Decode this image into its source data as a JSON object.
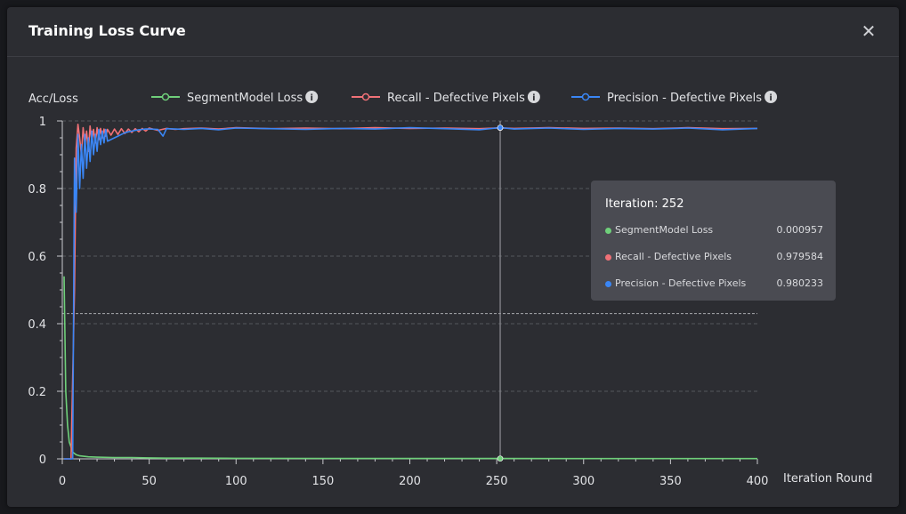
{
  "dialog": {
    "title": "Training Loss Curve",
    "close_icon": "close-icon"
  },
  "chart_data": {
    "type": "line",
    "ylabel": "Acc/Loss",
    "xlabel": "Iteration Round",
    "xlim": [
      0,
      400
    ],
    "ylim": [
      0,
      1
    ],
    "x_ticks": [
      "0",
      "50",
      "100",
      "150",
      "200",
      "250",
      "300",
      "350",
      "400"
    ],
    "y_ticks": [
      "0",
      "0.2",
      "0.4",
      "0.6",
      "0.8",
      "1"
    ],
    "grid": "horizontal-dashed",
    "reference_line_y": 0.43,
    "hover_x": 252,
    "legend_position": "top",
    "info_icon": "info-icon",
    "series": [
      {
        "name": "SegmentModel Loss",
        "color": "#6fcf7a",
        "x": [
          1,
          2,
          3,
          4,
          5,
          6,
          8,
          10,
          15,
          20,
          30,
          40,
          50,
          60,
          80,
          100,
          150,
          200,
          252,
          300,
          350,
          400
        ],
        "values": [
          0.54,
          0.2,
          0.1,
          0.05,
          0.035,
          0.02,
          0.012,
          0.009,
          0.006,
          0.005,
          0.004,
          0.004,
          0.003,
          0.002,
          0.002,
          0.0015,
          0.0012,
          0.001,
          0.000957,
          0.0009,
          0.0009,
          0.0009
        ]
      },
      {
        "name": "Recall - Defective Pixels",
        "color": "#f07177",
        "x": [
          1,
          5,
          7,
          8,
          9,
          10,
          11,
          12,
          13,
          14,
          15,
          16,
          17,
          18,
          19,
          20,
          21,
          22,
          23,
          24,
          25,
          26,
          28,
          30,
          32,
          34,
          36,
          38,
          40,
          42,
          44,
          46,
          48,
          50,
          55,
          60,
          65,
          70,
          80,
          90,
          100,
          120,
          140,
          160,
          180,
          200,
          220,
          240,
          252,
          260,
          280,
          300,
          320,
          340,
          360,
          380,
          400
        ],
        "values": [
          0.0,
          0.0,
          0.5,
          0.92,
          0.99,
          0.95,
          0.9,
          0.98,
          0.93,
          0.97,
          0.91,
          0.985,
          0.94,
          0.975,
          0.935,
          0.98,
          0.945,
          0.978,
          0.95,
          0.976,
          0.955,
          0.975,
          0.958,
          0.976,
          0.96,
          0.977,
          0.963,
          0.976,
          0.966,
          0.977,
          0.968,
          0.978,
          0.97,
          0.979,
          0.972,
          0.978,
          0.975,
          0.977,
          0.979,
          0.976,
          0.98,
          0.977,
          0.979,
          0.977,
          0.98,
          0.978,
          0.979,
          0.977,
          0.979584,
          0.978,
          0.98,
          0.978,
          0.979,
          0.977,
          0.98,
          0.977,
          0.978
        ]
      },
      {
        "name": "Precision - Defective Pixels",
        "color": "#3a86f5",
        "x": [
          1,
          6,
          7,
          8,
          9,
          10,
          11,
          12,
          13,
          14,
          15,
          16,
          17,
          18,
          19,
          20,
          21,
          22,
          23,
          24,
          25,
          26,
          28,
          30,
          32,
          34,
          36,
          38,
          40,
          42,
          44,
          46,
          48,
          50,
          55,
          58,
          60,
          65,
          70,
          80,
          90,
          100,
          120,
          140,
          160,
          180,
          200,
          220,
          240,
          252,
          260,
          280,
          300,
          320,
          340,
          360,
          380,
          400
        ],
        "values": [
          0.0,
          0.0,
          0.89,
          0.73,
          0.96,
          0.8,
          0.93,
          0.83,
          0.96,
          0.86,
          0.95,
          0.88,
          0.97,
          0.9,
          0.96,
          0.91,
          0.975,
          0.93,
          0.97,
          0.935,
          0.975,
          0.94,
          0.945,
          0.95,
          0.955,
          0.96,
          0.965,
          0.968,
          0.97,
          0.972,
          0.974,
          0.975,
          0.976,
          0.976,
          0.975,
          0.955,
          0.977,
          0.976,
          0.975,
          0.978,
          0.974,
          0.979,
          0.977,
          0.975,
          0.978,
          0.976,
          0.98,
          0.977,
          0.974,
          0.980233,
          0.976,
          0.979,
          0.975,
          0.978,
          0.976,
          0.979,
          0.974,
          0.978
        ]
      }
    ]
  },
  "tooltip": {
    "title": "Iteration: 252",
    "rows": [
      {
        "label": "SegmentModel Loss",
        "value": "0.000957",
        "color": "#6fcf7a"
      },
      {
        "label": "Recall - Defective Pixels",
        "value": "0.979584",
        "color": "#f07177"
      },
      {
        "label": "Precision - Defective Pixels",
        "value": "0.980233",
        "color": "#3a86f5"
      }
    ]
  }
}
